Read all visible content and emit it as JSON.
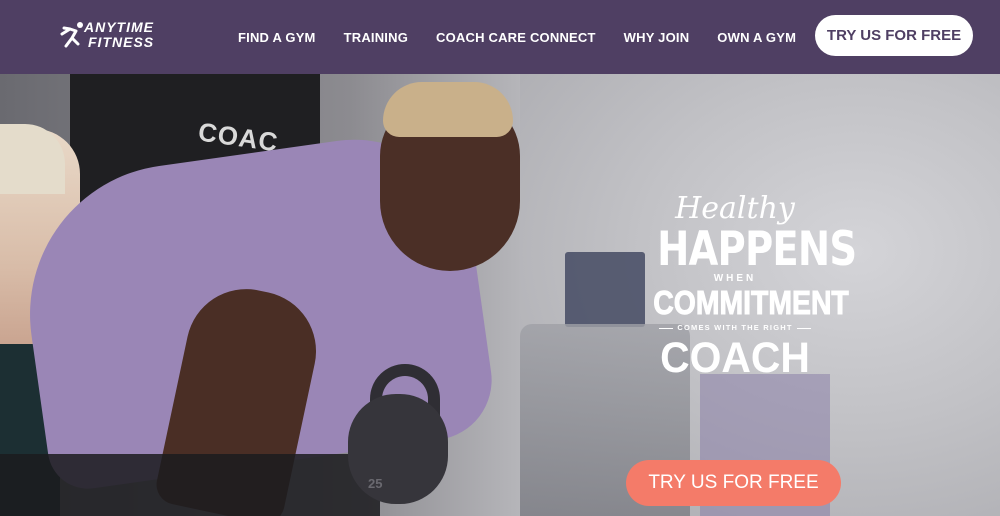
{
  "header": {
    "logo": {
      "line1": "ANYTIME",
      "line2": "FITNESS",
      "icon": "running-man-icon"
    },
    "nav": [
      {
        "label": "FIND A GYM"
      },
      {
        "label": "TRAINING"
      },
      {
        "label": "COACH CARE CONNECT"
      },
      {
        "label": "WHY JOIN"
      },
      {
        "label": "OWN A GYM"
      }
    ],
    "cta_label": "TRY US FOR FREE"
  },
  "hero": {
    "background_shirt_text": "COAC",
    "kettlebell_number": "25",
    "headline": {
      "healthy": "Healthy",
      "happens": "HAPPENS",
      "when": "WHEN",
      "commitment": "COMMITMENT",
      "comes": "COMES WITH THE RIGHT",
      "coach": "COACH"
    },
    "cta_label": "TRY US FOR FREE"
  },
  "colors": {
    "header_bg": "#4f3f63",
    "cta_header_bg": "#ffffff",
    "cta_hero_bg": "#f47b69"
  }
}
